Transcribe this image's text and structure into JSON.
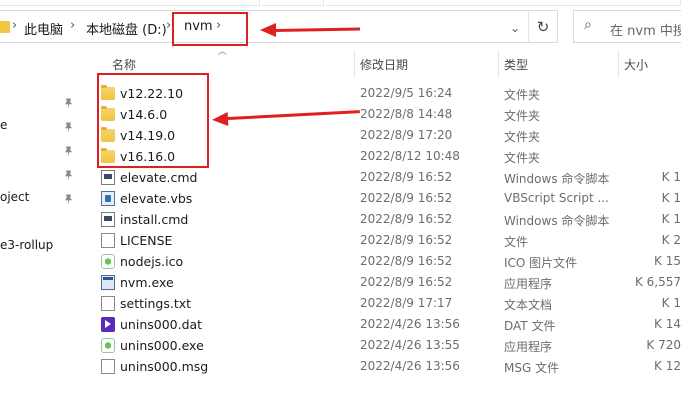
{
  "breadcrumb": {
    "items": [
      "此电脑",
      "本地磁盘 (D:)",
      "nvm"
    ],
    "separator": "›"
  },
  "search": {
    "placeholder": "在 nvm 中搜索"
  },
  "columns": {
    "name": "名称",
    "date": "修改日期",
    "type": "类型",
    "size": "大小"
  },
  "nav": {
    "items": [
      "e",
      "oject",
      "e3-rollup"
    ]
  },
  "files": [
    {
      "name": "v12.22.10",
      "date": "2022/9/5 16:24",
      "type": "文件夹",
      "size": "",
      "icon": "folder-icon"
    },
    {
      "name": "v14.6.0",
      "date": "2022/8/8 14:48",
      "type": "文件夹",
      "size": "",
      "icon": "folder-icon"
    },
    {
      "name": "v14.19.0",
      "date": "2022/8/9 17:20",
      "type": "文件夹",
      "size": "",
      "icon": "folder-icon"
    },
    {
      "name": "v16.16.0",
      "date": "2022/8/12 10:48",
      "type": "文件夹",
      "size": "",
      "icon": "folder-icon"
    },
    {
      "name": "elevate.cmd",
      "date": "2022/8/9 16:52",
      "type": "Windows 命令脚本",
      "size": "1 K",
      "icon": "cmd-file-icon"
    },
    {
      "name": "elevate.vbs",
      "date": "2022/8/9 16:52",
      "type": "VBScript Script ...",
      "size": "1 K",
      "icon": "vbs-file-icon"
    },
    {
      "name": "install.cmd",
      "date": "2022/8/9 16:52",
      "type": "Windows 命令脚本",
      "size": "1 K",
      "icon": "cmd-file-icon"
    },
    {
      "name": "LICENSE",
      "date": "2022/8/9 16:52",
      "type": "文件",
      "size": "2 K",
      "icon": "document-icon"
    },
    {
      "name": "nodejs.ico",
      "date": "2022/8/9 16:52",
      "type": "ICO 图片文件",
      "size": "15 K",
      "icon": "nodejs-icon"
    },
    {
      "name": "nvm.exe",
      "date": "2022/8/9 16:52",
      "type": "应用程序",
      "size": "6,557 K",
      "icon": "exe-icon"
    },
    {
      "name": "settings.txt",
      "date": "2022/8/9 17:17",
      "type": "文本文档",
      "size": "1 K",
      "icon": "text-file-icon"
    },
    {
      "name": "unins000.dat",
      "date": "2022/4/26 13:56",
      "type": "DAT 文件",
      "size": "14 K",
      "icon": "dat-file-icon"
    },
    {
      "name": "unins000.exe",
      "date": "2022/4/26 13:55",
      "type": "应用程序",
      "size": "720 K",
      "icon": "uninstaller-icon"
    },
    {
      "name": "unins000.msg",
      "date": "2022/4/26 13:56",
      "type": "MSG 文件",
      "size": "12 K",
      "icon": "document-icon"
    }
  ],
  "colors": {
    "annotation": "#e02020",
    "folder": "#f1c33f"
  }
}
